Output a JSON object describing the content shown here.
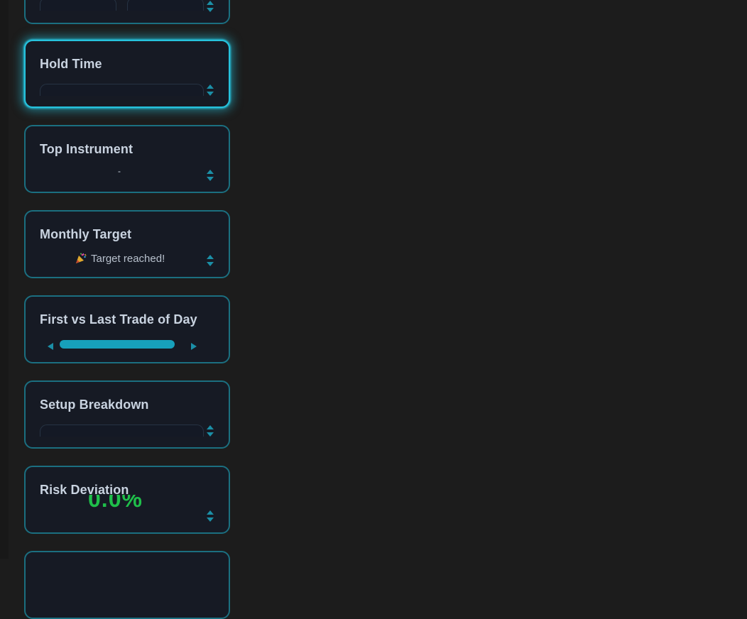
{
  "panels": [
    {
      "title": "",
      "kind": "partial-top"
    },
    {
      "title": "Hold Time",
      "kind": "tabs",
      "active": true
    },
    {
      "title": "Top Instrument",
      "value": "-"
    },
    {
      "title": "Monthly Target",
      "status_text": "Target reached!",
      "status_icon": "party-popper-icon"
    },
    {
      "title": "First vs Last Trade of Day",
      "kind": "horizontal-scroll"
    },
    {
      "title": "Setup Breakdown",
      "kind": "tabs"
    },
    {
      "title": "Risk Deviation",
      "value": "0.0%"
    },
    {
      "title": "",
      "kind": "partial-bottom"
    }
  ],
  "colors": {
    "background": "#1c1c1c",
    "panel_bg": "#161a24",
    "panel_border": "#1b6f80",
    "active_border": "#26c2dd",
    "accent": "#17a0bb",
    "positive": "#1fbf4a",
    "title_text": "#c9d3e0"
  }
}
